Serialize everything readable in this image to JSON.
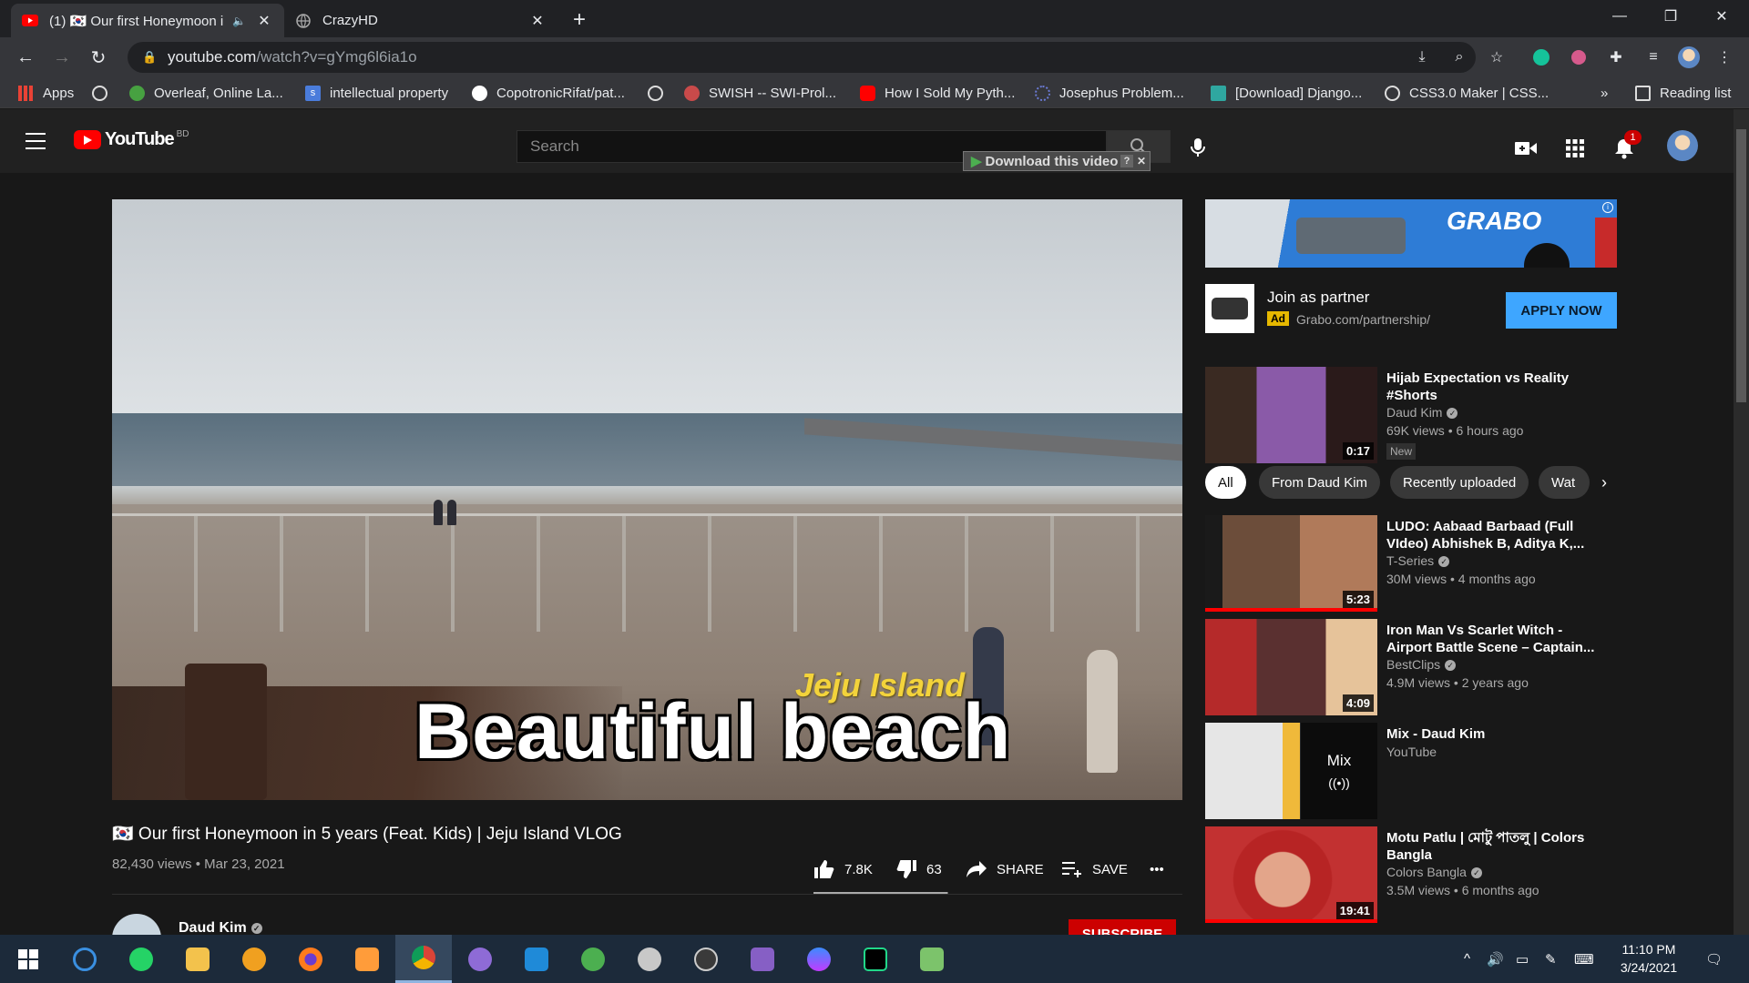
{
  "browser": {
    "tabs": [
      {
        "title": "(1) 🇰🇷 Our first Honeymoon i",
        "active": true
      },
      {
        "title": "CrazyHD",
        "active": false
      }
    ],
    "url_host": "youtube.com",
    "url_path": "/watch?v=gYmg6l6ia1o",
    "bookmarks": [
      {
        "label": "Apps"
      },
      {
        "label": ""
      },
      {
        "label": "Overleaf, Online La..."
      },
      {
        "label": "intellectual property"
      },
      {
        "label": "CopotronicRifat/pat..."
      },
      {
        "label": ""
      },
      {
        "label": "SWISH -- SWI-Prol..."
      },
      {
        "label": "How I Sold My Pyth..."
      },
      {
        "label": "Josephus Problem..."
      },
      {
        "label": "[Download] Django..."
      },
      {
        "label": "CSS3.0 Maker | CSS..."
      }
    ],
    "bookmarks_overflow": "»",
    "reading_list": "Reading list"
  },
  "youtube": {
    "logo_text": "YouTube",
    "country_code": "BD",
    "search_placeholder": "Search",
    "download_overlay": "Download this video",
    "notification_count": "1",
    "video": {
      "caption_main": "Beautiful beach",
      "caption_place": "Jeju Island",
      "title": "🇰🇷 Our first Honeymoon in 5 years (Feat. Kids) | Jeju Island VLOG",
      "views": "82,430 views",
      "date": "Mar 23, 2021",
      "likes": "7.8K",
      "dislikes": "63",
      "like_ratio": 0.99,
      "share_label": "SHARE",
      "save_label": "SAVE",
      "more": "•••",
      "channel": "Daud Kim",
      "subscribe_label": "SUBSCRIBE"
    },
    "ad": {
      "banner_brand": "GRABO",
      "title": "Join as partner",
      "badge": "Ad",
      "url": "Grabo.com/partnership/",
      "cta": "APPLY NOW"
    },
    "chips": [
      "All",
      "From Daud Kim",
      "Recently uploaded",
      "Wat"
    ],
    "recommendations": [
      {
        "title": "Hijab Expectation vs Reality #Shorts",
        "channel": "Daud Kim",
        "verified": true,
        "meta": "69K views • 6 hours ago",
        "duration": "0:17",
        "tag": "New",
        "watched": false
      },
      {
        "title": "LUDO: Aabaad Barbaad (Full VIdeo) Abhishek B, Aditya K,...",
        "channel": "T-Series",
        "verified": true,
        "meta": "30M views • 4 months ago",
        "duration": "5:23",
        "tag": "",
        "watched": true
      },
      {
        "title": "Iron Man Vs Scarlet Witch - Airport Battle Scene – Captain...",
        "channel": "BestClips",
        "verified": true,
        "meta": "4.9M views • 2 years ago",
        "duration": "4:09",
        "tag": "",
        "watched": false
      },
      {
        "title": "Mix - Daud Kim",
        "channel": "YouTube",
        "verified": false,
        "meta": "",
        "duration": "",
        "tag": "",
        "watched": false,
        "mix_label": "Mix"
      },
      {
        "title": "Motu Patlu | মোটু পাতলু | Colors Bangla",
        "channel": "Colors Bangla",
        "verified": true,
        "meta": "3.5M views • 6 months ago",
        "duration": "19:41",
        "tag": "",
        "watched": true
      }
    ]
  },
  "taskbar": {
    "time": "11:10 PM",
    "date": "3/24/2021"
  },
  "colors": {
    "youtube_red": "#ff0000",
    "apply_blue": "#3ea6ff",
    "subscribe_red": "#cc0000"
  }
}
